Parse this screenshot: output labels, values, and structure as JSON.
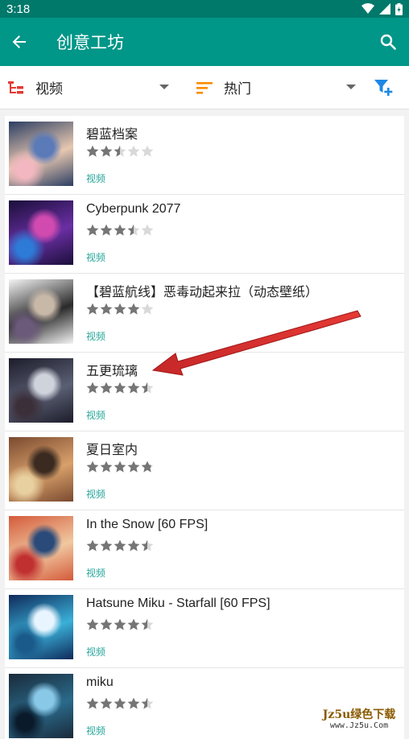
{
  "statusbar": {
    "time": "3:18"
  },
  "appbar": {
    "title": "创意工坊"
  },
  "filters": {
    "type_label": "视频",
    "sort_label": "热门"
  },
  "colors": {
    "primary": "#009688",
    "primary_dark": "#00796b",
    "accent": "#26a69a",
    "filter_icon": "#1e88e5",
    "type_icon": "#e53935",
    "sort_icon": "#fb8c00",
    "star_on": "#757575",
    "star_off": "#d9d9d9",
    "arrow": "#d32f2f"
  },
  "items": [
    {
      "title": "碧蓝档案",
      "rating": 2.5,
      "category": "视频",
      "palette": [
        "#2b3e63",
        "#e8c8b0",
        "#5a7ab8",
        "#f2b7c0"
      ]
    },
    {
      "title": "Cyberpunk 2077",
      "rating": 3.5,
      "category": "视频",
      "palette": [
        "#1a0f3a",
        "#6a2fa3",
        "#d04ab0",
        "#2d7bd6"
      ]
    },
    {
      "title": "【碧蓝航线】恶毒动起来拉（动态壁纸）",
      "rating": 4,
      "category": "视频",
      "palette": [
        "#f4f4f4",
        "#2a2a2a",
        "#c7b8a8",
        "#6b5a7a"
      ]
    },
    {
      "title": "五更琉璃",
      "rating": 4.5,
      "category": "视频",
      "palette": [
        "#1c1c2a",
        "#5a5f73",
        "#cfd3dc",
        "#3b2f3a"
      ]
    },
    {
      "title": "夏日室内",
      "rating": 4.8,
      "category": "视频",
      "palette": [
        "#7a4a30",
        "#d8a06a",
        "#3a2a20",
        "#e8d0a0"
      ]
    },
    {
      "title": "In the Snow [60 FPS]",
      "rating": 4.5,
      "category": "视频",
      "palette": [
        "#d45a3a",
        "#f0c8a0",
        "#2a4a7a",
        "#c03030"
      ]
    },
    {
      "title": "Hatsune Miku - Starfall [60 FPS]",
      "rating": 4.5,
      "category": "视频",
      "palette": [
        "#0f2a5a",
        "#3ab0d8",
        "#e8f4ff",
        "#1a5a8a"
      ]
    },
    {
      "title": "miku",
      "rating": 4.5,
      "category": "视频",
      "palette": [
        "#1a2a3a",
        "#2a6a8a",
        "#8ac8e8",
        "#0a1a2a"
      ]
    }
  ],
  "watermark": {
    "line1": "Jz5u绿色下载",
    "line2": "www.Jz5u.Com"
  }
}
